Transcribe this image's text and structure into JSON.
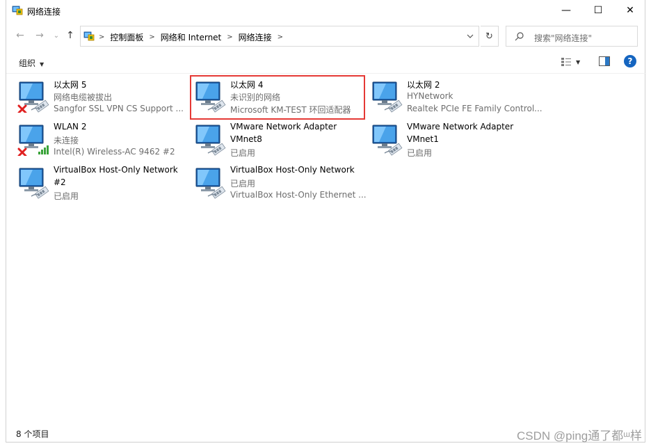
{
  "window": {
    "title": "网络连接",
    "controls": {
      "minimize": "—",
      "maximize": "☐",
      "close": "✕"
    }
  },
  "nav": {
    "back": "←",
    "forward": "→",
    "recent": "⌄",
    "up": "↑",
    "breadcrumbs": [
      "控制面板",
      "网络和 Internet",
      "网络连接"
    ],
    "refresh": "↻",
    "search_placeholder": "搜索\"网络连接\""
  },
  "toolbar": {
    "organize_label": "组织",
    "help": "?"
  },
  "connections": [
    {
      "name": "以太网 5",
      "status": "网络电缆被拔出",
      "device": "Sangfor SSL VPN CS Support ...",
      "state": "disconnected",
      "kind": "ethernet"
    },
    {
      "name": "以太网 4",
      "status": "未识别的网络",
      "device": "Microsoft KM-TEST 环回适配器",
      "state": "connected",
      "kind": "ethernet",
      "selected": true
    },
    {
      "name": "以太网 2",
      "status": "HYNetwork",
      "device": "Realtek PCIe FE Family Control...",
      "state": "connected",
      "kind": "ethernet"
    },
    {
      "name": "WLAN 2",
      "status": "未连接",
      "device": "Intel(R) Wireless-AC 9462 #2",
      "state": "disconnected",
      "kind": "wifi"
    },
    {
      "name": "VMware Network Adapter",
      "status": "VMnet8",
      "device": "已启用",
      "state": "enabled",
      "kind": "ethernet"
    },
    {
      "name": "VMware Network Adapter",
      "status": "VMnet1",
      "device": "已启用",
      "state": "enabled",
      "kind": "ethernet"
    },
    {
      "name": "VirtualBox Host-Only Network",
      "status": "#2",
      "device": "已启用",
      "state": "enabled",
      "kind": "ethernet"
    },
    {
      "name": "VirtualBox Host-Only Network",
      "status": "已启用",
      "device": "VirtualBox Host-Only Ethernet ...",
      "state": "enabled",
      "kind": "ethernet"
    }
  ],
  "status_bar": {
    "item_count": "8 个项目",
    "watermark": "CSDN @ping通了都ᵚ样"
  },
  "colors": {
    "selection_outline": "#e53935",
    "help_blue": "#1565c0",
    "secondary_text": "#6d6d6d"
  }
}
